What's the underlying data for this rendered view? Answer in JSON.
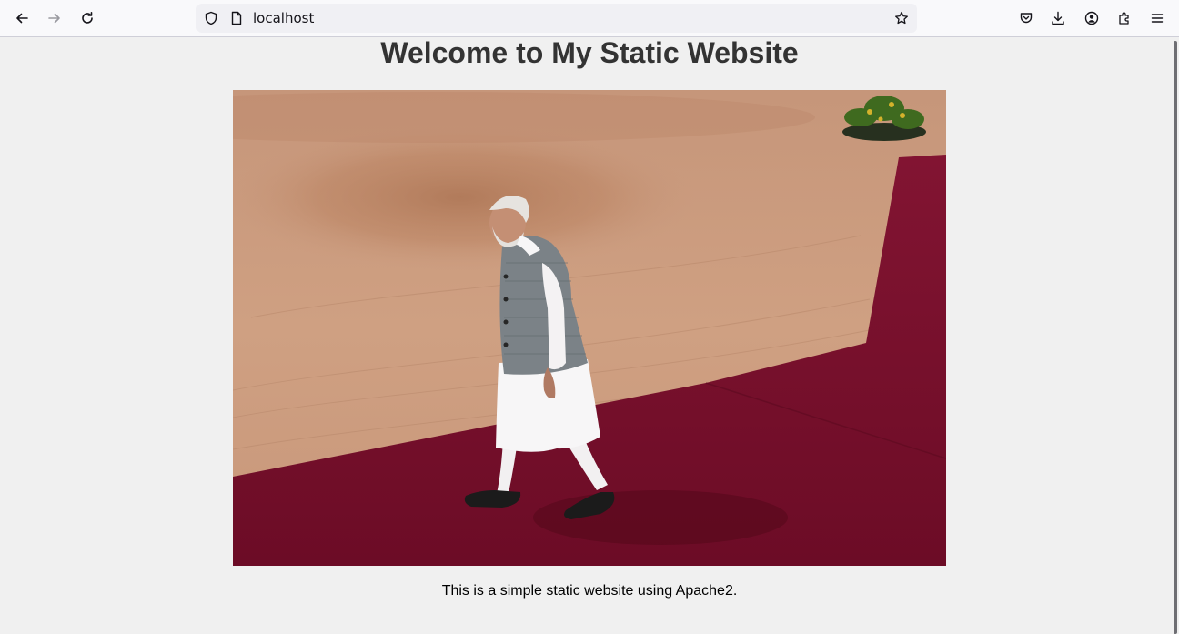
{
  "browser": {
    "url": "localhost",
    "icons": {
      "back": "back-arrow-icon",
      "forward": "forward-arrow-icon",
      "reload": "reload-icon",
      "shield": "tracking-shield-icon",
      "page": "page-icon",
      "bookmark": "bookmark-star-icon",
      "pocket": "pocket-icon",
      "downloads": "download-icon",
      "account": "account-icon",
      "extensions": "extensions-icon",
      "menu": "hamburger-menu-icon"
    }
  },
  "page": {
    "title": "Welcome to My Static Website",
    "caption": "This is a simple static website using Apache2.",
    "image": {
      "subject": "photo-man-walking-red-carpet"
    }
  },
  "colors": {
    "page_background": "#f0f0f0",
    "title_color": "#333333",
    "carpet": "#7a1030",
    "sand": "#c99a76"
  }
}
